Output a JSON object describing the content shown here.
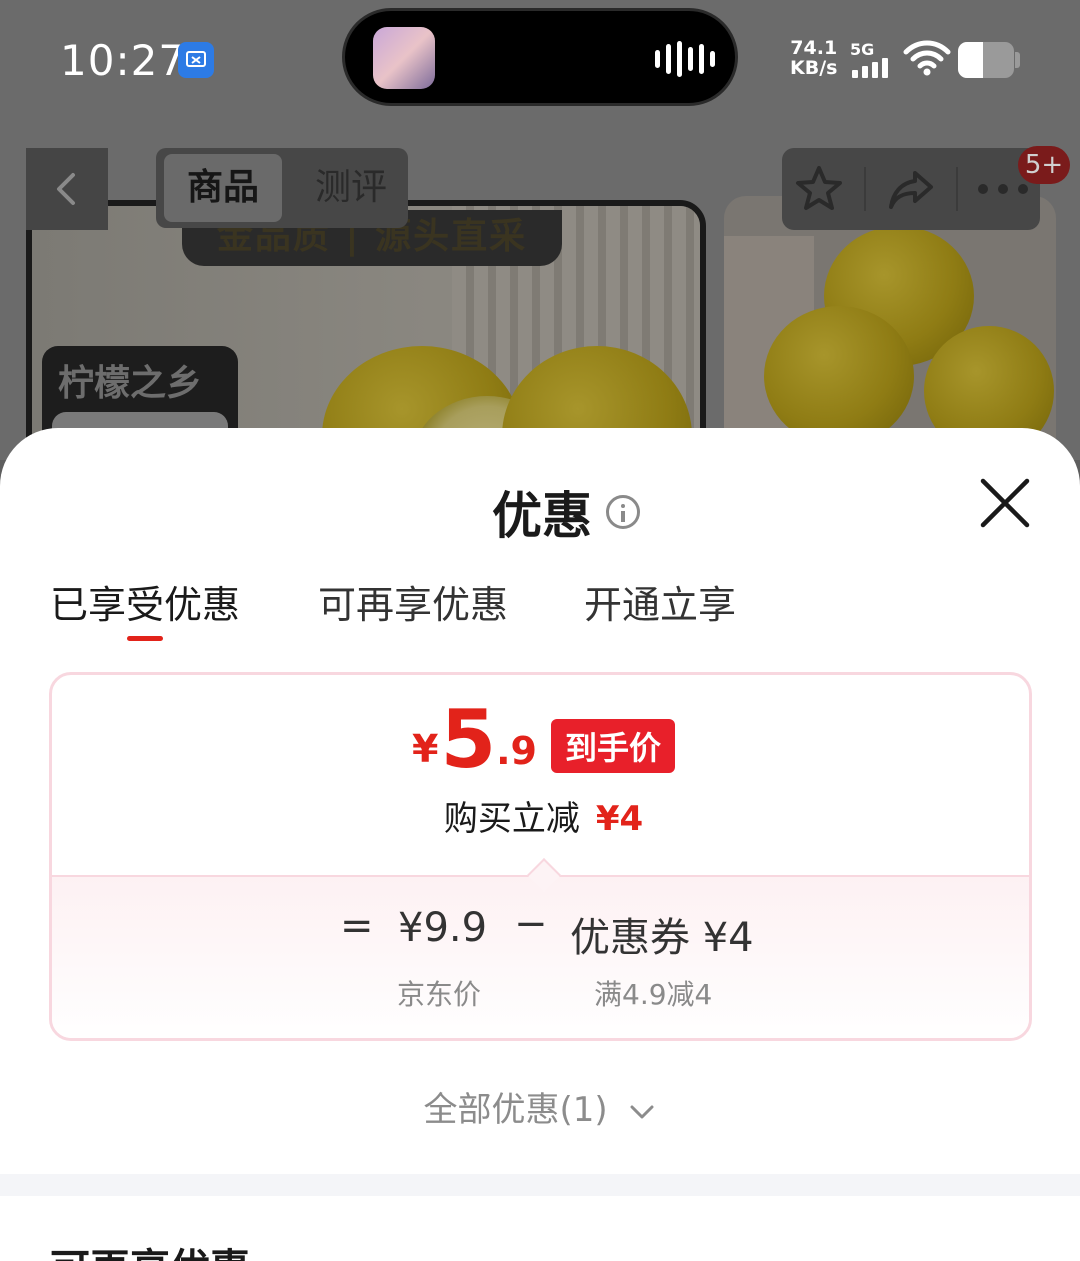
{
  "status_bar": {
    "time": "10:27",
    "net_speed_value": "74.1",
    "net_speed_unit": "KB/s",
    "network_type": "5G",
    "battery_level": 0.45
  },
  "header": {
    "segment_tabs": [
      "商品",
      "测评"
    ],
    "active_segment": "商品",
    "cart_badge": "5+"
  },
  "background_image_text": {
    "banner": "金品质 | 源头直采",
    "tag": "柠檬之乡"
  },
  "sheet": {
    "title": "优惠",
    "tabs": [
      "已享受优惠",
      "可再享优惠",
      "开通立享"
    ],
    "active_tab": "已享受优惠",
    "price_card": {
      "currency": "¥",
      "price_integer": "5",
      "price_decimal": ".9",
      "price_label": "到手价",
      "reduce_text": "购买立减",
      "reduce_amount": "¥4",
      "equals": "=",
      "base_price": "¥9.9",
      "base_label": "京东价",
      "minus": "−",
      "coupon": "优惠券 ¥4",
      "coupon_condition": "满4.9减4"
    },
    "all_discounts": "全部优惠(1)",
    "next_section_title": "可再享优惠"
  },
  "colors": {
    "accent_red": "#e2231a",
    "card_border": "#f8d7df"
  }
}
